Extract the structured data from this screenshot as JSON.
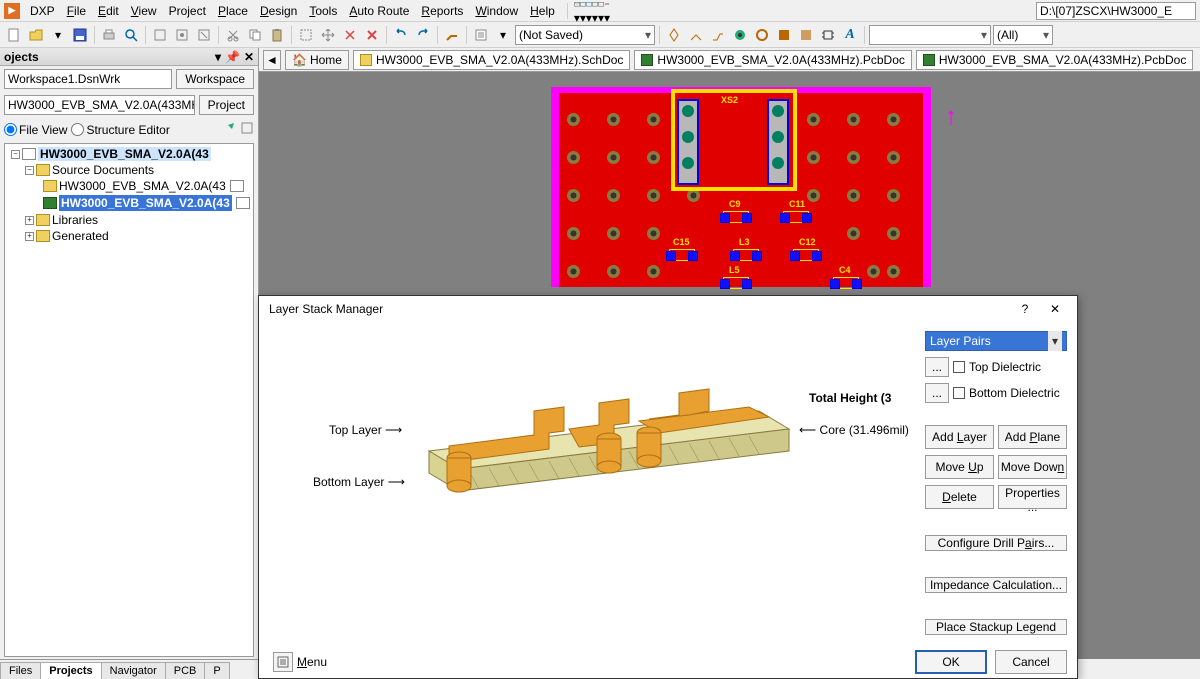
{
  "path_display": "D:\\[07]ZSCX\\HW3000_E",
  "menus": {
    "dxp": "DXP",
    "file": "File",
    "edit": "Edit",
    "view": "View",
    "project": "Project",
    "place": "Place",
    "design": "Design",
    "tools": "Tools",
    "autoroute": "Auto Route",
    "reports": "Reports",
    "window": "Window",
    "help": "Help"
  },
  "toolbar": {
    "notsaved": "(Not Saved)",
    "filter_all": "(All)"
  },
  "projects_panel": {
    "title": "ojects",
    "workspace_combo": "Workspace1.DsnWrk",
    "workspace_btn": "Workspace",
    "project_combo": "HW3000_EVB_SMA_V2.0A(433MHz",
    "project_btn": "Project",
    "fileview": "File View",
    "structeditor": "Structure Editor"
  },
  "tree": {
    "root": "HW3000_EVB_SMA_V2.0A(43",
    "srcdocs": "Source Documents",
    "sch": "HW3000_EVB_SMA_V2.0A(43",
    "pcb": "HW3000_EVB_SMA_V2.0A(43",
    "libraries": "Libraries",
    "generated": "Generated"
  },
  "doctabs": {
    "home": "Home",
    "sch": "HW3000_EVB_SMA_V2.0A(433MHz).SchDoc",
    "pcb1": "HW3000_EVB_SMA_V2.0A(433MHz).PcbDoc",
    "pcb2": "HW3000_EVB_SMA_V2.0A(433MHz).PcbDoc"
  },
  "bottom_tabs": {
    "files": "Files",
    "projects": "Projects",
    "navigator": "Navigator",
    "pcb": "PCB",
    "p": "P"
  },
  "pcb_labels": {
    "xs2": "XS2",
    "c9": "C9",
    "c11": "C11",
    "c15": "C15",
    "l3": "L3",
    "c12": "C12",
    "l5": "L5",
    "c4": "C4"
  },
  "dialog": {
    "title": "Layer Stack Manager",
    "help": "?",
    "close": "✕",
    "total_height": "Total Height (3",
    "core": "Core (31.496mil)",
    "top_layer": "Top Layer",
    "bottom_layer": "Bottom Layer",
    "layer_pairs": "Layer Pairs",
    "top_dielectric": "Top Dielectric",
    "bottom_dielectric": "Bottom Dielectric",
    "add_layer": "Add Layer",
    "add_plane": "Add Plane",
    "move_up": "Move Up",
    "move_down": "Move Down",
    "delete": "Delete",
    "properties": "Properties ...",
    "configure_drill": "Configure Drill Pairs...",
    "impedance": "Impedance Calculation...",
    "place_legend": "Place Stackup Legend",
    "menu": "Menu",
    "ok": "OK",
    "cancel": "Cancel",
    "ellipsis": "..."
  }
}
